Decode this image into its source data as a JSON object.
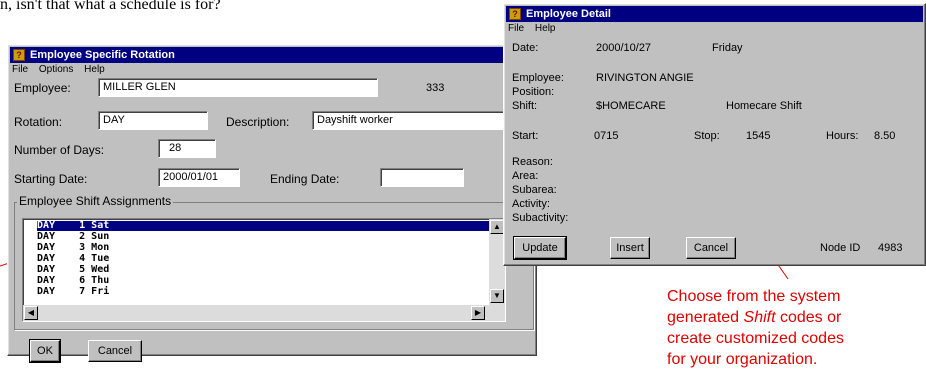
{
  "top_text": "n, isn't that what a schedule is for?",
  "rotation_window": {
    "title": "Employee Specific Rotation",
    "menu": [
      "File",
      "Options",
      "Help"
    ],
    "employee_label": "Employee:",
    "employee_value": "MILLER GLEN",
    "employee_id": "333",
    "rotation_label": "Rotation:",
    "rotation_value": "DAY",
    "description_label": "Description:",
    "description_value": "Dayshift worker",
    "days_label": "Number of Days:",
    "days_value": "28",
    "start_label": "Starting Date:",
    "start_value": "2000/01/01",
    "end_label": "Ending Date:",
    "end_value": "",
    "group_label": "Employee Shift Assignments",
    "rows": [
      "DAY    1 Sat",
      "DAY    2 Sun",
      "DAY    3 Mon",
      "DAY    4 Tue",
      "DAY    5 Wed",
      "DAY    6 Thu",
      "DAY    7 Fri"
    ],
    "ok_label": "OK",
    "cancel_label": "Cancel"
  },
  "detail_window": {
    "title": "Employee Detail",
    "menu": [
      "File",
      "Help"
    ],
    "date_label": "Date:",
    "date_value": "2000/10/27",
    "day_value": "Friday",
    "employee_label": "Employee:",
    "employee_value": "RIVINGTON ANGIE",
    "position_label": "Position:",
    "shift_label": "Shift:",
    "shift_code": "$HOMECARE",
    "shift_desc": "Homecare Shift",
    "start_label": "Start:",
    "start_value": "0715",
    "stop_label": "Stop:",
    "stop_value": "1545",
    "hours_label": "Hours:",
    "hours_value": "8.50",
    "reason_label": "Reason:",
    "area_label": "Area:",
    "subarea_label": "Subarea:",
    "activity_label": "Activity:",
    "subactivity_label": "Subactivity:",
    "update_label": "Update",
    "insert_label": "Insert",
    "cancel_label": "Cancel",
    "node_label": "Node ID",
    "node_value": "4983"
  },
  "annotation": {
    "lines": [
      "Choose from the system",
      "generated ",
      "Shift",
      " codes or",
      "create customized codes",
      "for your organization."
    ]
  },
  "colors": {
    "titlebar": "#000080",
    "annotation": "#e00000",
    "window": "#c0c0c0"
  }
}
